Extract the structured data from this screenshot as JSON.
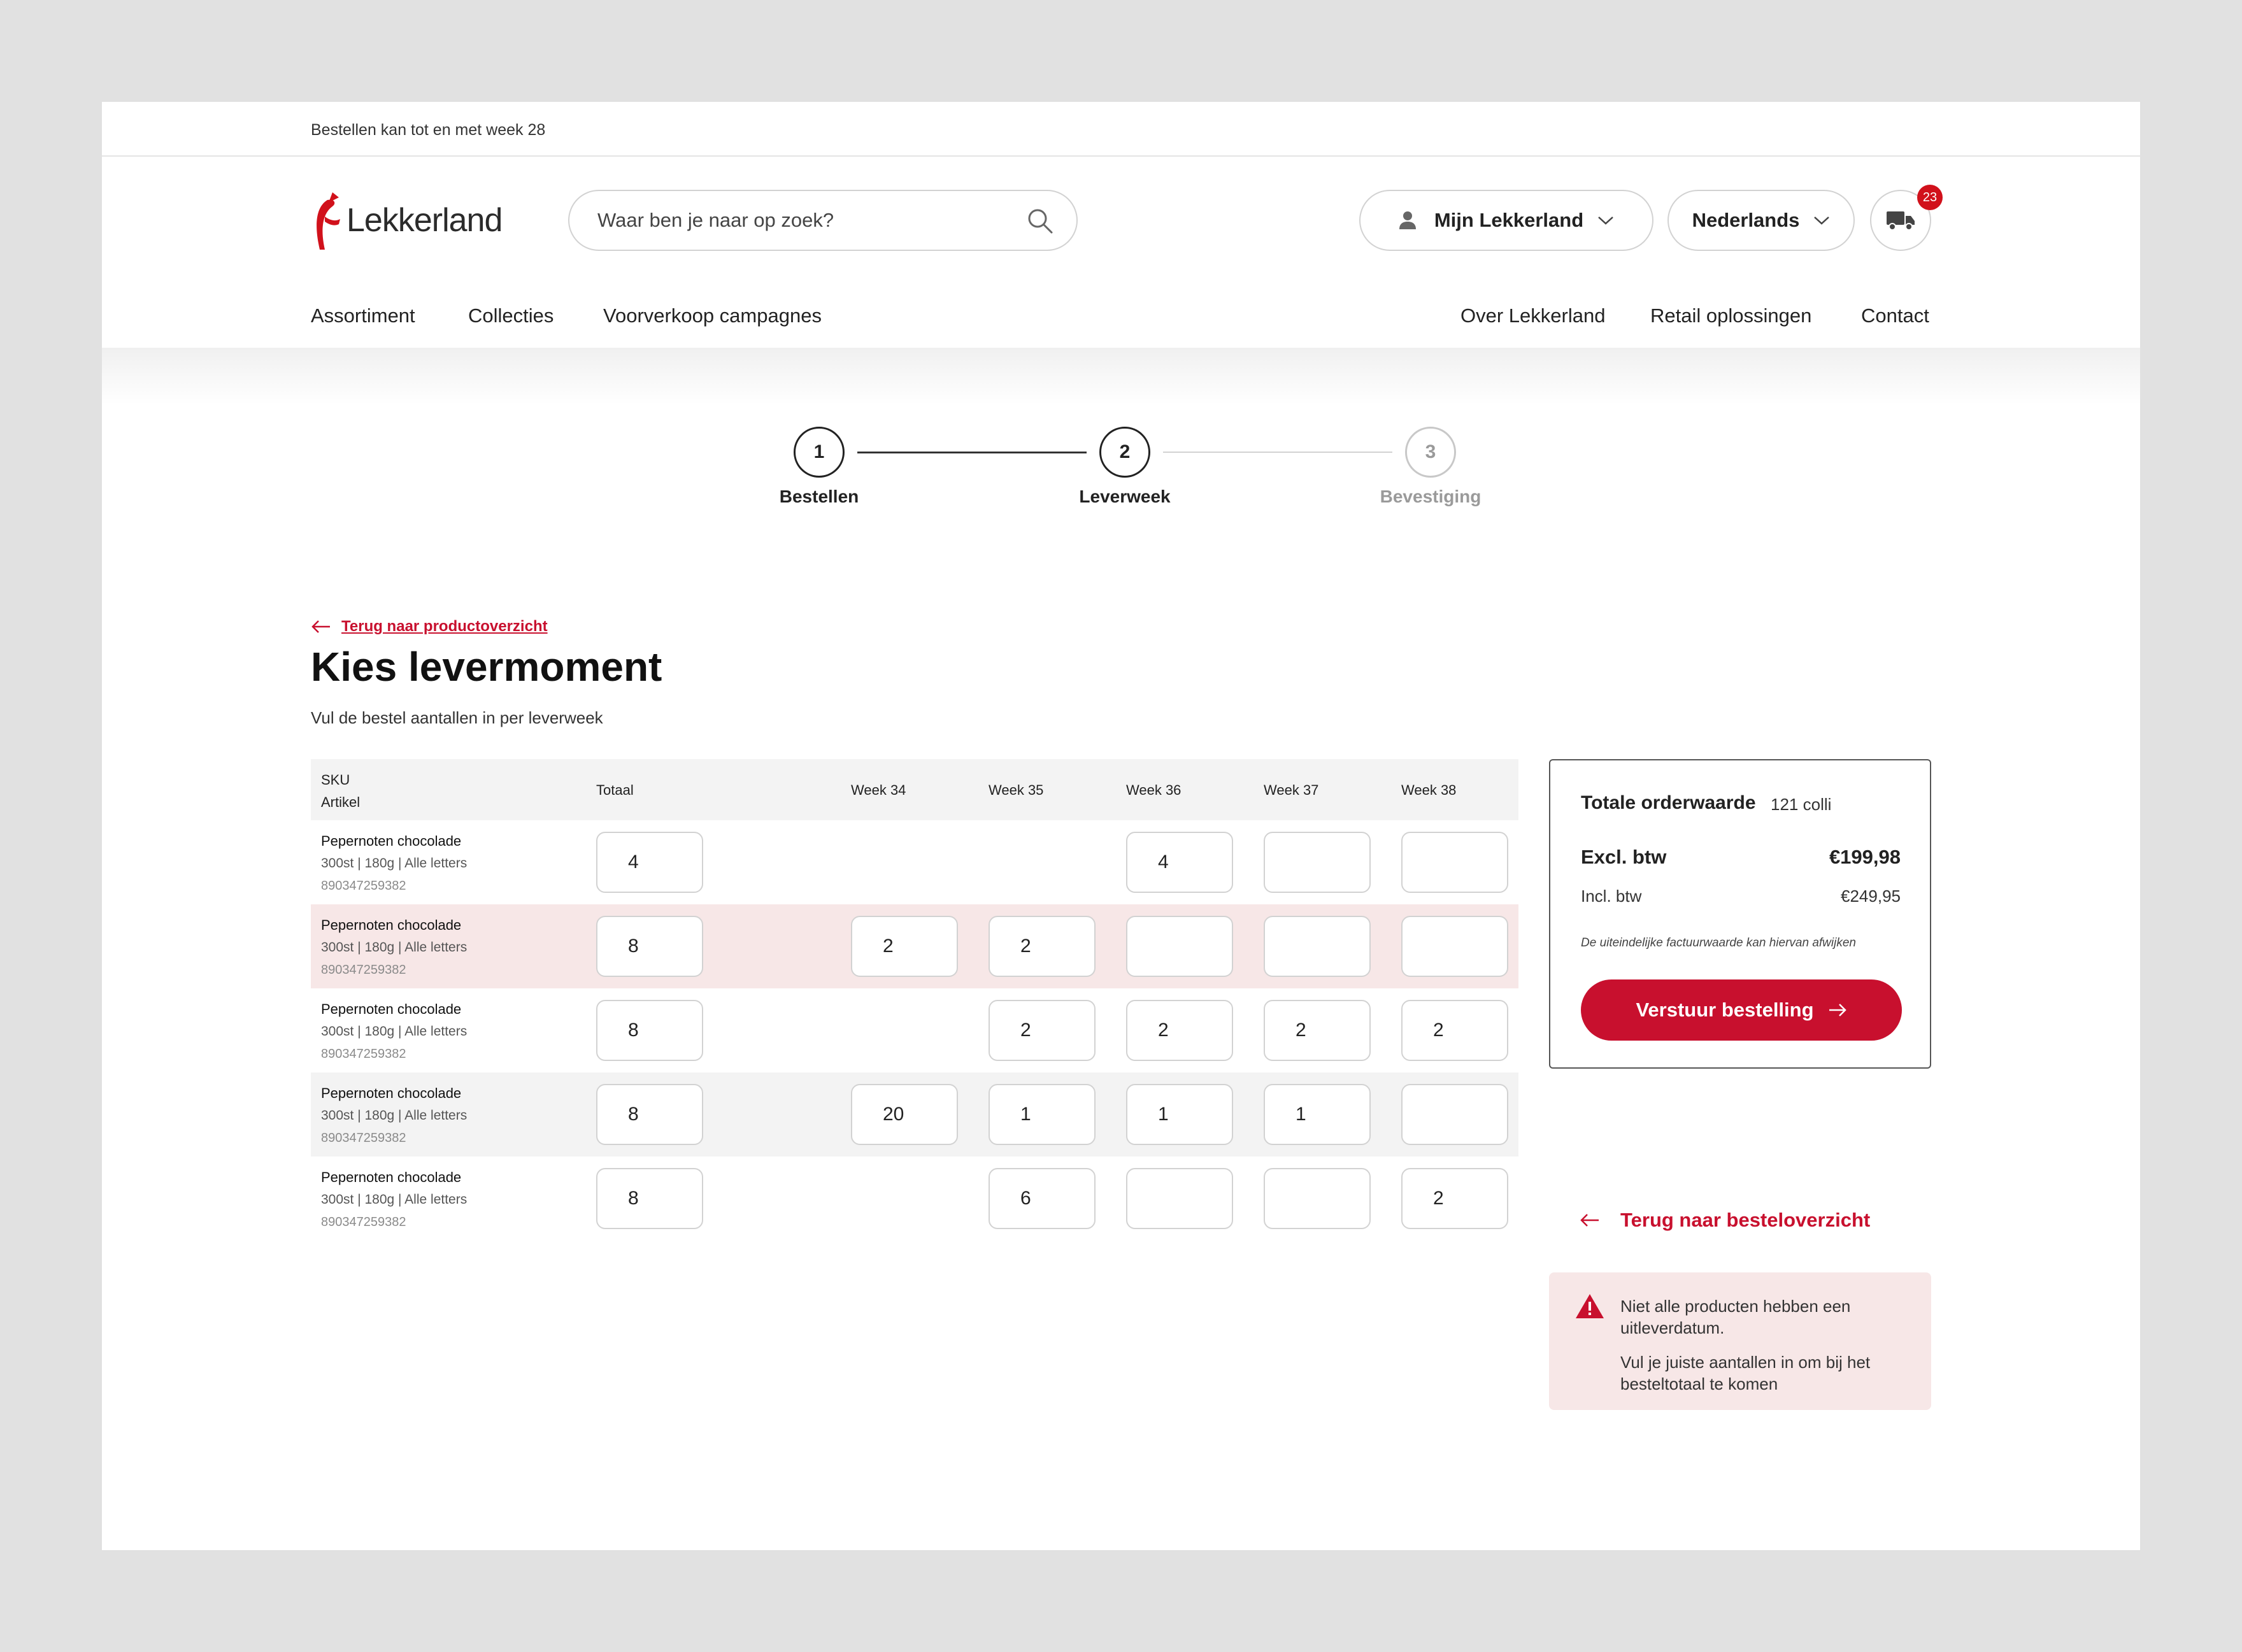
{
  "topbar": {
    "notice": "Bestellen kan tot en met week 28"
  },
  "header": {
    "logo_text": "Lekkerland",
    "search_placeholder": "Waar ben je naar op zoek?",
    "account_label": "Mijn Lekkerland",
    "language_label": "Nederlands",
    "cart_count": "23",
    "nav_left": [
      "Assortiment",
      "Collecties",
      "Voorverkoop campagnes"
    ],
    "nav_right": [
      "Over Lekkerland",
      "Retail oplossingen",
      "Contact"
    ]
  },
  "stepper": [
    {
      "number": "1",
      "label": "Bestellen",
      "state": "done"
    },
    {
      "number": "2",
      "label": "Leverweek",
      "state": "active"
    },
    {
      "number": "3",
      "label": "Bevestiging",
      "state": "upcoming"
    }
  ],
  "main": {
    "back_link": "Terug naar productoverzicht",
    "title": "Kies levermoment",
    "subtitle": "Vul de bestel aantallen in per leverweek"
  },
  "table": {
    "headers": {
      "sku": "SKU",
      "article": "Artikel",
      "total": "Totaal",
      "weeks": [
        "Week 34",
        "Week 35",
        "Week 36",
        "Week 37",
        "Week 38"
      ]
    },
    "rows": [
      {
        "name": "Pepernoten chocolade",
        "meta": "300st | 180g | Alle letters",
        "sku": "890347259382",
        "total": "4",
        "weeks": [
          null,
          null,
          "4",
          "",
          ""
        ],
        "status": "normal"
      },
      {
        "name": "Pepernoten chocolade",
        "meta": "300st | 180g | Alle letters",
        "sku": "890347259382",
        "total": "8",
        "weeks": [
          "2",
          "2",
          "",
          "",
          ""
        ],
        "status": "alert"
      },
      {
        "name": "Pepernoten chocolade",
        "meta": "300st | 180g | Alle letters",
        "sku": "890347259382",
        "total": "8",
        "weeks": [
          null,
          "2",
          "2",
          "2",
          "2"
        ],
        "status": "normal"
      },
      {
        "name": "Pepernoten chocolade",
        "meta": "300st | 180g | Alle letters",
        "sku": "890347259382",
        "total": "8",
        "weeks": [
          "20",
          "1",
          "1",
          "1",
          ""
        ],
        "status": "grey"
      },
      {
        "name": "Pepernoten chocolade",
        "meta": "300st | 180g | Alle letters",
        "sku": "890347259382",
        "total": "8",
        "weeks": [
          null,
          "6",
          "",
          "",
          "2"
        ],
        "status": "normal"
      }
    ]
  },
  "summary": {
    "title": "Totale orderwaarde",
    "colli": "121 colli",
    "excl_label": "Excl. btw",
    "excl_value": "€199,98",
    "incl_label": "Incl. btw",
    "incl_value": "€249,95",
    "note": "De uiteindelijke factuurwaarde kan hiervan afwijken",
    "submit_label": "Verstuur bestelling",
    "back_label": "Terug naar besteloverzicht"
  },
  "warning": {
    "line1": "Niet alle producten hebben een uitleverdatum.",
    "line2": "Vul je juiste aantallen in om bij het besteltotaal te komen"
  },
  "colors": {
    "brand_red": "#c8102e",
    "alert_bg": "#f7e7e7",
    "row_grey": "#f3f3f3"
  }
}
